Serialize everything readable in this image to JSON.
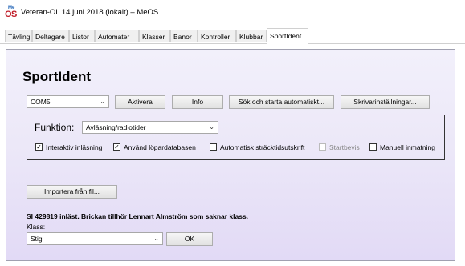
{
  "window": {
    "title": "Veteran-OL 14 juni 2018 (lokalt) – MeOS",
    "icon": "meos-icon",
    "icon_text_top": "Me",
    "icon_text_bottom": "OS"
  },
  "tabs": [
    {
      "label": "Tävling"
    },
    {
      "label": "Deltagare"
    },
    {
      "label": "Listor"
    },
    {
      "label": "Automater"
    },
    {
      "label": "Klasser"
    },
    {
      "label": "Banor"
    },
    {
      "label": "Kontroller"
    },
    {
      "label": "Klubbar"
    },
    {
      "label": "SportIdent"
    }
  ],
  "active_tab": "SportIdent",
  "page": {
    "heading": "SportIdent",
    "port": {
      "value": "COM5"
    },
    "buttons": {
      "activate": "Aktivera",
      "info": "Info",
      "search_start": "Sök och starta automatiskt...",
      "printer": "Skrivarinställningar..."
    },
    "function": {
      "label": "Funktion:",
      "value": "Avläsning/radiotider"
    },
    "checkboxes": [
      {
        "label": "Interaktiv inläsning",
        "checked": true,
        "enabled": true
      },
      {
        "label": "Använd löpardatabasen",
        "checked": true,
        "enabled": true
      },
      {
        "label": "Automatisk sträcktidsutskrift",
        "checked": false,
        "enabled": true
      },
      {
        "label": "Startbevis",
        "checked": false,
        "enabled": false
      },
      {
        "label": "Manuell inmatning",
        "checked": false,
        "enabled": true
      }
    ],
    "import_button": "Importera från fil...",
    "status_text": "SI 429819 inläst. Brickan tillhör Lennart Almström som saknar klass.",
    "class": {
      "label": "Klass:",
      "value": "Stig"
    },
    "ok_button": "OK"
  },
  "colors": {
    "panel_top": "#f2f0fb",
    "panel_bottom": "#e2daf6",
    "title_accent": "#c01c28"
  }
}
